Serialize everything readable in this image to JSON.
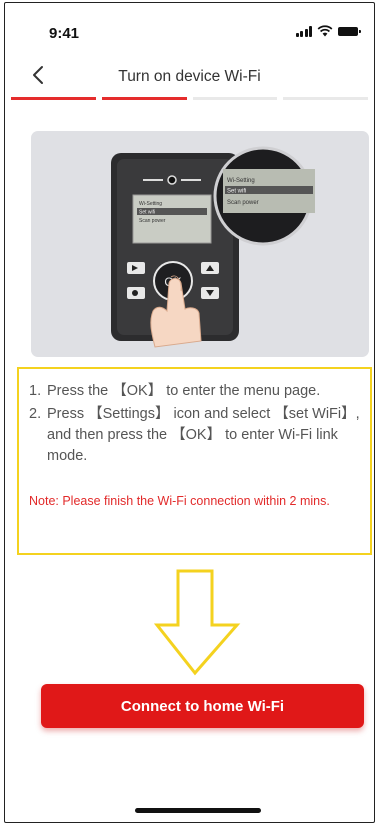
{
  "status_bar": {
    "time": "9:41",
    "icons": [
      "signal-icon",
      "wifi-icon",
      "battery-icon"
    ]
  },
  "nav": {
    "title": "Turn on device Wi-Fi",
    "back_icon": "chevron-left-icon"
  },
  "progress": {
    "total_steps": 4,
    "active_steps": 2
  },
  "illustration": {
    "device_screen": {
      "menu_items": [
        "Wi-Setting",
        "Set wifi",
        "Scan power"
      ]
    },
    "buttons": [
      "OK"
    ]
  },
  "instructions": {
    "steps": [
      {
        "number": "1.",
        "text": "Press the 【OK】 to enter the menu page."
      },
      {
        "number": "2.",
        "text": "Press 【Settings】 icon and select 【set WiFi】, and then press the 【OK】 to enter Wi-Fi link mode."
      }
    ],
    "note": "Note: Please finish the Wi-Fi connection within 2 mins."
  },
  "cta": {
    "label": "Connect to home Wi-Fi"
  },
  "colors": {
    "accent": "#e01818",
    "highlight": "#f4d21f",
    "progress_active": "#e52c2c",
    "progress_inactive": "#e9e9e9"
  }
}
